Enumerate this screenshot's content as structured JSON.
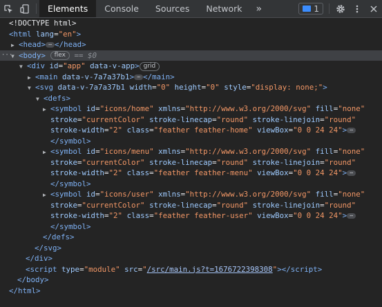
{
  "toolbar": {
    "tabs": [
      "Elements",
      "Console",
      "Sources",
      "Network"
    ],
    "more": "»",
    "issues_count": "1",
    "settings_icon": "gear-icon",
    "menu_icon": "kebab-menu-icon",
    "close_icon": "close-icon"
  },
  "dom": {
    "doctype": "<!DOCTYPE html>",
    "html_tag": "html",
    "html_attr_name": "lang",
    "html_attr_val": "\"en\"",
    "head_tag": "head",
    "body_tag": "body",
    "body_pill": "flex",
    "body_selected": "== $0",
    "div_tag": "div",
    "div_id_name": "id",
    "div_id_val": "\"app\"",
    "div_extra": "data-v-app",
    "div_pill": "grid",
    "main_tag": "main",
    "main_attr": "data-v-7a7a37b1",
    "svg_tag": "svg",
    "svg_attr1": "data-v-7a7a37b1",
    "svg_w_name": "width",
    "svg_w_val": "\"0\"",
    "svg_h_name": "height",
    "svg_h_val": "\"0\"",
    "svg_style_name": "style",
    "svg_style_val": "\"display: none;\"",
    "defs_tag": "defs",
    "symbols": [
      {
        "id": "\"icons/home\"",
        "class": "\"feather feather-home\""
      },
      {
        "id": "\"icons/menu\"",
        "class": "\"feather feather-menu\""
      },
      {
        "id": "\"icons/user\"",
        "class": "\"feather feather-user\""
      }
    ],
    "symbol_tag": "symbol",
    "xmlns_val": "\"http://www.w3.org/2000/svg\"",
    "fill_val": "\"none\"",
    "stroke_val": "\"currentColor\"",
    "linecap_val": "\"round\"",
    "linejoin_val": "\"round\"",
    "stroke_width_val": "\"2\"",
    "viewbox_val": "\"0 0 24 24\"",
    "script_tag": "script",
    "script_type_val": "\"module\"",
    "script_src": "/src/main.js?t=1676722398308"
  },
  "colors": {
    "tag": "#7fb2f5",
    "attr_name": "#9fcbff",
    "attr_value": "#f29766",
    "selected_row": "#3f4145",
    "background": "#242424"
  }
}
